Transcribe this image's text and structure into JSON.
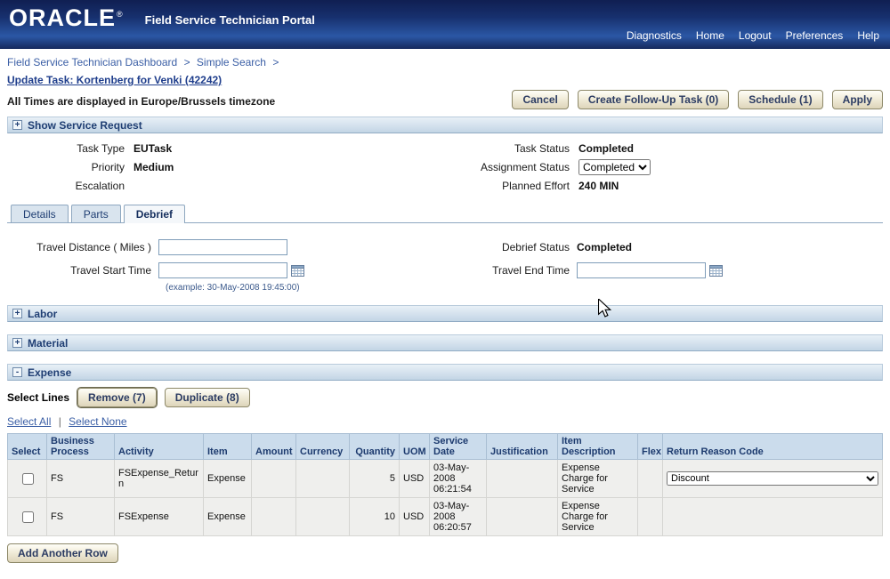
{
  "theme": {
    "header_blue": "#17306e",
    "section_bar_blue": "#c3d5e5",
    "link_blue": "#3a5ea5",
    "button_face": "#f1ecd9",
    "table_header_blue": "#cbdcec"
  },
  "header": {
    "brand": "ORACLE",
    "brand_mark": "®",
    "app_title": "Field Service Technician Portal",
    "nav": [
      "Diagnostics",
      "Home",
      "Logout",
      "Preferences",
      "Help"
    ]
  },
  "breadcrumb": {
    "items": [
      "Field Service Technician Dashboard",
      "Simple Search"
    ],
    "separator": ">"
  },
  "page": {
    "title": "Update Task: Kortenberg for Venki (42242)",
    "timezone_note": "All Times are displayed in Europe/Brussels timezone"
  },
  "actions": {
    "cancel": "Cancel",
    "create_followup": "Create Follow-Up Task (0)",
    "schedule": "Schedule (1)",
    "apply": "Apply"
  },
  "service_request": {
    "title": "Show Service Request",
    "toggle": "+"
  },
  "task": {
    "labels": {
      "task_type": "Task Type",
      "priority": "Priority",
      "escalation": "Escalation",
      "task_status": "Task Status",
      "assignment_status": "Assignment Status",
      "planned_effort": "Planned Effort"
    },
    "values": {
      "task_type": "EUTask",
      "priority": "Medium",
      "escalation": "",
      "task_status": "Completed",
      "assignment_status": "Completed",
      "planned_effort": "240 MIN"
    }
  },
  "tabs": [
    {
      "label": "Details"
    },
    {
      "label": "Parts"
    },
    {
      "label": "Debrief"
    }
  ],
  "debrief": {
    "labels": {
      "travel_distance": "Travel Distance ( Miles )",
      "travel_start": "Travel Start Time",
      "debrief_status": "Debrief Status",
      "travel_end": "Travel End Time"
    },
    "travel_start_hint": "(example: 30-May-2008 19:45:00)",
    "debrief_status_value": "Completed"
  },
  "sections": {
    "labor": {
      "title": "Labor",
      "toggle": "+"
    },
    "material": {
      "title": "Material",
      "toggle": "+"
    },
    "expense": {
      "title": "Expense",
      "toggle": "-"
    }
  },
  "expense": {
    "select_lines_label": "Select Lines",
    "remove_button": "Remove (7)",
    "duplicate_button": "Duplicate (8)",
    "select_all": "Select All",
    "select_none": "Select None",
    "link_divider": "|",
    "columns": [
      "Select",
      "Business Process",
      "Activity",
      "Item",
      "Amount",
      "Currency",
      "Quantity",
      "UOM",
      "Service Date",
      "Justification",
      "Item Description",
      "Flex",
      "Return Reason Code"
    ],
    "rows": [
      {
        "business_process": "FS",
        "activity": "FSExpense_Return",
        "item": "Expense",
        "amount": "",
        "currency": "",
        "quantity": "5",
        "uom": "USD",
        "service_date": "03-May-2008 06:21:54",
        "justification": "",
        "item_description": "Expense Charge for Service",
        "flex": "",
        "return_reason_code": "Discount"
      },
      {
        "business_process": "FS",
        "activity": "FSExpense",
        "item": "Expense",
        "amount": "",
        "currency": "",
        "quantity": "10",
        "uom": "USD",
        "service_date": "03-May-2008 06:20:57",
        "justification": "",
        "item_description": "Expense Charge for Service",
        "flex": "",
        "return_reason_code": ""
      }
    ],
    "add_row_button": "Add Another Row"
  }
}
